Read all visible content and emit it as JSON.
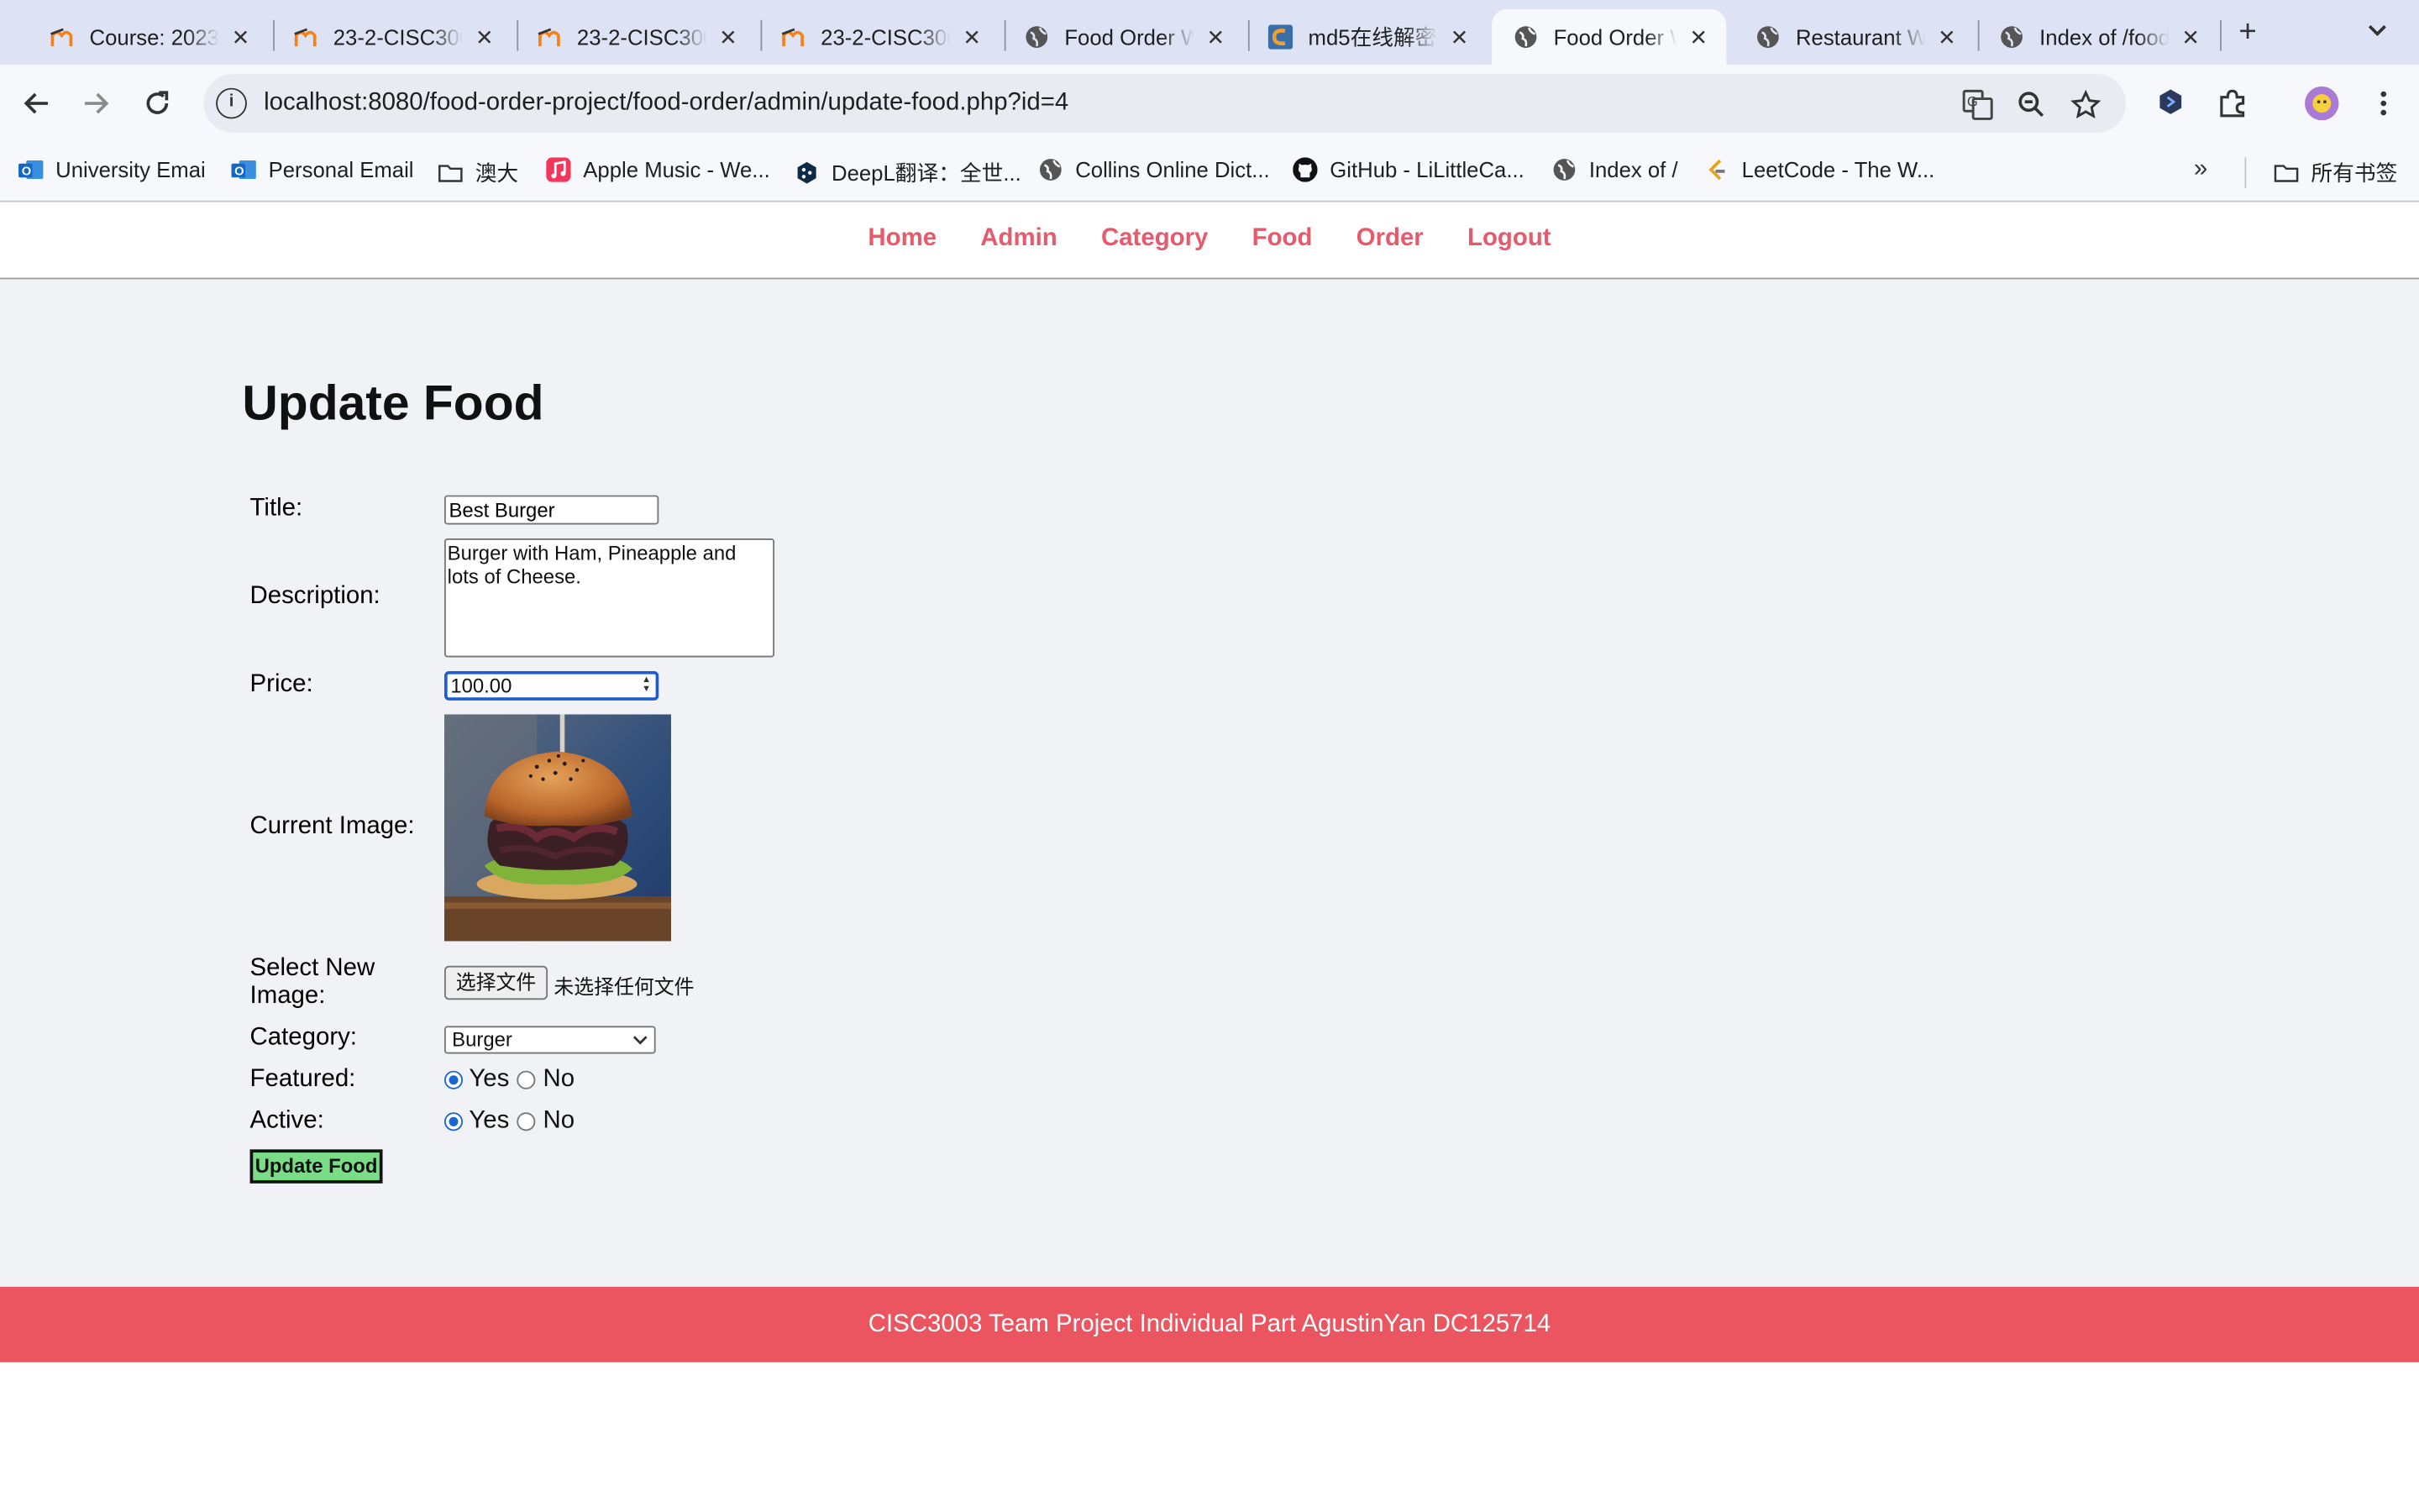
{
  "browser": {
    "tabs": [
      {
        "title": "Course: 2023",
        "icon": "moodle-icon"
      },
      {
        "title": "23-2-CISC3003",
        "icon": "moodle-icon"
      },
      {
        "title": "23-2-CISC3003",
        "icon": "moodle-icon"
      },
      {
        "title": "23-2-CISC3003",
        "icon": "moodle-icon"
      },
      {
        "title": "Food Order Website",
        "icon": "globe-icon"
      },
      {
        "title": "md5在线解密破解",
        "icon": "cmd5-icon"
      },
      {
        "title": "Food Order Website",
        "icon": "globe-icon",
        "active": true
      },
      {
        "title": "Restaurant Website",
        "icon": "globe-icon"
      },
      {
        "title": "Index of /food",
        "icon": "globe-icon"
      }
    ],
    "url": "localhost:8080/food-order-project/food-order/admin/update-food.php?id=4",
    "bookmarks": [
      {
        "label": "University Emai",
        "icon": "outlook-icon"
      },
      {
        "label": "Personal Email",
        "icon": "outlook-icon"
      },
      {
        "label": "澳大",
        "icon": "folder-icon"
      },
      {
        "label": "Apple Music - We...",
        "icon": "apple-music-icon"
      },
      {
        "label": "DeepL翻译：全世...",
        "icon": "deepl-icon"
      },
      {
        "label": "Collins Online Dict...",
        "icon": "globe-icon"
      },
      {
        "label": "GitHub - LiLittleCa...",
        "icon": "github-icon"
      },
      {
        "label": "Index of /",
        "icon": "globe-icon"
      },
      {
        "label": "LeetCode - The W...",
        "icon": "leetcode-icon"
      }
    ],
    "all_bookmarks": "所有书签"
  },
  "nav": {
    "links": [
      "Home",
      "Admin",
      "Category",
      "Food",
      "Order",
      "Logout"
    ]
  },
  "form": {
    "heading": "Update Food",
    "title_label": "Title:",
    "title_value": "Best Burger",
    "description_label": "Description:",
    "description_value": "Burger with Ham, Pineapple and lots of Cheese.",
    "price_label": "Price:",
    "price_value": "100.00",
    "current_image_label": "Current Image:",
    "new_image_label": "Select New Image:",
    "file_button": "选择文件",
    "file_status": "未选择任何文件",
    "category_label": "Category:",
    "category_value": "Burger",
    "featured_label": "Featured:",
    "active_label": "Active:",
    "yes": "Yes",
    "no": "No",
    "featured": "Yes",
    "active": "Yes",
    "submit": "Update Food"
  },
  "footer": {
    "text": "CISC3003 Team Project Individual Part AgustinYan DC125714"
  },
  "colors": {
    "nav_link": "#e65a6b",
    "footer_bg": "#ea5560",
    "submit_bg": "#7bdc87",
    "page_bg": "#f1f2f6"
  }
}
